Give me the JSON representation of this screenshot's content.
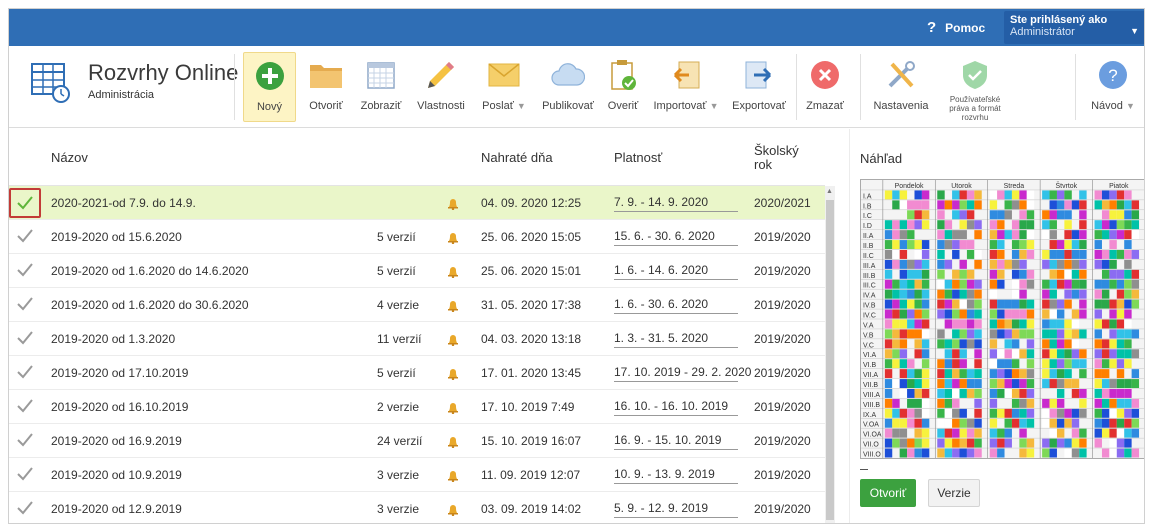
{
  "header": {
    "help_label": "Pomoc",
    "user_line1": "Ste prihlásený ako",
    "user_line2": "Administrátor"
  },
  "brand": {
    "name": "Rozvrhy Online",
    "subtitle": "Administrácia"
  },
  "toolbar": {
    "new": "Nový",
    "open": "Otvoriť",
    "show": "Zobraziť",
    "properties": "Vlastnosti",
    "send": "Poslať",
    "publish": "Publikovať",
    "verify": "Overiť",
    "import": "Importovať",
    "export": "Exportovať",
    "delete": "Zmazať",
    "settings": "Nastavenia",
    "rights_line1": "Používateľské",
    "rights_line2": "práva a formát",
    "rights_line3": "rozvrhu",
    "guide": "Návod"
  },
  "table": {
    "col_name": "Názov",
    "col_uploaded": "Nahraté dňa",
    "col_validity": "Platnosť",
    "col_year_line1": "Školský",
    "col_year_line2": "rok",
    "rows": [
      {
        "name": "2020-2021-od 7.9. do 14.9.",
        "versions": "",
        "uploaded": "04. 09. 2020 12:25",
        "validity": "7. 9. - 14. 9. 2020",
        "year": "2020/2021",
        "selected": true
      },
      {
        "name": "2019-2020 od 15.6.2020",
        "versions": "5 verzií",
        "uploaded": "25. 06. 2020 15:05",
        "validity": "15. 6. - 30. 6. 2020",
        "year": "2019/2020"
      },
      {
        "name": "2019-2020 od 1.6.2020 do 14.6.2020",
        "versions": "5 verzií",
        "uploaded": "25. 06. 2020 15:01",
        "validity": "1. 6. - 14. 6. 2020",
        "year": "2019/2020"
      },
      {
        "name": "2019-2020 od 1.6.2020 do 30.6.2020",
        "versions": "4 verzie",
        "uploaded": "31. 05. 2020 17:38",
        "validity": "1. 6. - 30. 6. 2020",
        "year": "2019/2020"
      },
      {
        "name": "2019-2020 od 1.3.2020",
        "versions": "11 verzií",
        "uploaded": "04. 03. 2020 13:18",
        "validity": "1. 3. - 31. 5. 2020",
        "year": "2019/2020"
      },
      {
        "name": "2019-2020 od 17.10.2019",
        "versions": "5 verzií",
        "uploaded": "17. 01. 2020 13:45",
        "validity": "17. 10. 2019 - 29. 2. 2020",
        "year": "2019/2020"
      },
      {
        "name": "2019-2020 od 16.10.2019",
        "versions": "2 verzie",
        "uploaded": "17. 10. 2019 7:49",
        "validity": "16. 10. - 16. 10. 2019",
        "year": "2019/2020"
      },
      {
        "name": "2019-2020 od 16.9.2019",
        "versions": "24 verzií",
        "uploaded": "15. 10. 2019 16:07",
        "validity": "16. 9. - 15. 10. 2019",
        "year": "2019/2020"
      },
      {
        "name": "2019-2020 od 10.9.2019",
        "versions": "3 verzie",
        "uploaded": "11. 09. 2019 12:07",
        "validity": "10. 9. - 13. 9. 2019",
        "year": "2019/2020"
      },
      {
        "name": "2019-2020 od 12.9.2019",
        "versions": "3 verzie",
        "uploaded": "03. 09. 2019 14:02",
        "validity": "5. 9. - 12. 9. 2019",
        "year": "2019/2020"
      }
    ]
  },
  "preview": {
    "title": "Náhľad",
    "days": [
      "Pondelok",
      "Utorok",
      "Streda",
      "Štvrtok",
      "Piatok"
    ],
    "classes": [
      "I.A",
      "I.B",
      "I.C",
      "I.D",
      "II.A",
      "II.B",
      "II.C",
      "III.A",
      "III.B",
      "III.C",
      "IV.A",
      "IV.B",
      "IV.C",
      "V.A",
      "V.B",
      "V.C",
      "VI.A",
      "VI.B",
      "VII.A",
      "VII.B",
      "VIII.A",
      "VIII.B",
      "IX.A",
      "V.OA",
      "VI.OA",
      "VII.O",
      "VIII.O"
    ],
    "open_button": "Otvoriť",
    "versions_button": "Verzie"
  },
  "colors": {
    "topbar": "#2f6eb5",
    "selected_row": "#eaf6c9",
    "open_button": "#3ca13f",
    "check_green": "#5fb53a",
    "check_gray": "#9a9a9a",
    "highlight_border": "#c23b37"
  },
  "icons": {
    "new": "plus-circle-icon",
    "open": "folder-icon",
    "show": "calendar-grid-icon",
    "properties": "pencil-icon",
    "send": "envelope-icon",
    "publish": "cloud-icon",
    "verify": "clipboard-check-icon",
    "import": "import-icon",
    "export": "export-icon",
    "delete": "delete-x-icon",
    "settings": "tools-icon",
    "rights": "shield-check-icon",
    "guide": "question-icon",
    "row_check": "checkmark-icon",
    "row_bell": "bell-icon"
  }
}
